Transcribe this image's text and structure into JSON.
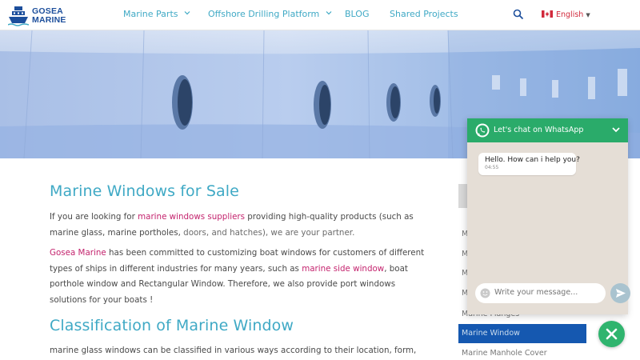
{
  "header": {
    "logo_line1": "GOSEA",
    "logo_line2": "MARINE",
    "nav": [
      {
        "label": "Marine Parts"
      },
      {
        "label": "Offshore Drilling Platform"
      },
      {
        "label": "BLOG"
      },
      {
        "label": "Shared Projects"
      }
    ],
    "language": "English"
  },
  "main": {
    "title": "Marine Windows for Sale",
    "p1": {
      "t1": "If you are looking for ",
      "link1": "marine windows suppliers",
      "t2": " providing high-quality products (such as marine glass, marine portholes, ",
      "t3": "doors, and hatches), we are your partner."
    },
    "p2": {
      "link1": "Gosea Marine",
      "t1": " has been committed to customizing boat windows for customers of different types of ships in different industries for many years, such as ",
      "link2": "marine side window",
      "t2": ", boat porthole window and Rectangular Window. Therefore, we also provide port windows solutions for your boats !"
    },
    "h2": "Classification of Marine Window",
    "p3": "marine glass windows can be classified in various ways according to their location, form, structure, material and function."
  },
  "sidebar": {
    "items": [
      {
        "label": "M"
      },
      {
        "label": "M"
      },
      {
        "label": "M"
      },
      {
        "label": "M"
      },
      {
        "label": "Marine Flanges"
      },
      {
        "label": "Marine Window"
      },
      {
        "label": "Marine Manhole Cover"
      }
    ]
  },
  "whatsapp": {
    "title": "Let's chat on WhatsApp",
    "message": "Hello. How can i help you?",
    "time": "04:55",
    "placeholder": "Write your message..."
  },
  "colors": {
    "accent": "#3fa9c5",
    "link": "#c4246e",
    "whatsapp": "#2aab6a",
    "sidebar_active": "#1558b0"
  }
}
